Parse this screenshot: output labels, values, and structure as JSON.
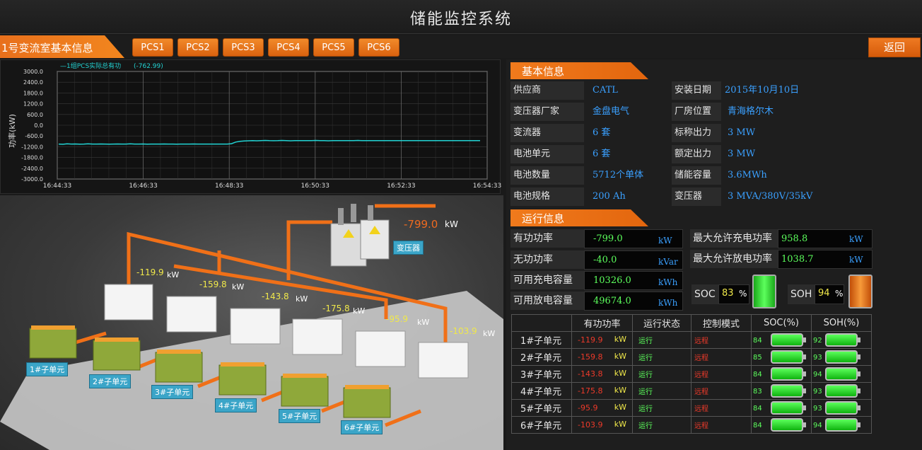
{
  "app": {
    "title": "储能监控系统"
  },
  "nav": {
    "room_tab": "1号变流室基本信息",
    "pcs_tabs": [
      "PCS1",
      "PCS2",
      "PCS3",
      "PCS4",
      "PCS5",
      "PCS6"
    ],
    "back_label": "返回"
  },
  "chart_data": {
    "type": "line",
    "legend": "—1组PCS实际总有功",
    "legend_value": "(-762.99)",
    "ylabel": "功率(kW)",
    "yticks": [
      "3000.0",
      "2400.0",
      "1800.0",
      "1200.0",
      "600.0",
      "0.0",
      "-600.0",
      "-1200.0",
      "-1800.0",
      "-2400.0",
      "-3000.0"
    ],
    "ylim": [
      -3000,
      3000
    ],
    "x": [
      "16:44:33",
      "16:46:33",
      "16:48:33",
      "16:50:33",
      "16:52:33",
      "16:54:33"
    ],
    "series": [
      {
        "name": "1组PCS实际总有功",
        "color": "#22d3d3",
        "values": [
          -1050,
          -1060,
          -1040,
          -1050,
          -1045,
          -1055,
          -1050,
          -1040,
          -1050,
          -1050,
          -1045,
          -1050,
          -1055,
          -1050,
          -1045,
          -1050,
          -1050,
          -1040,
          -1050,
          -1050,
          -1048,
          -1052,
          -1050,
          -1050,
          -1050,
          -1045,
          -1050,
          -1050,
          -1052,
          -1050,
          -1050,
          -1050,
          -1048,
          -1050,
          -1050,
          -1050,
          -1050,
          -1050,
          -1050,
          -1050,
          -1050,
          -1030,
          -940,
          -900,
          -880,
          -870,
          -860,
          -870,
          -860,
          -850,
          -860,
          -865,
          -860,
          -850,
          -860,
          -870,
          -860,
          -855,
          -860,
          -860,
          -860,
          -850,
          -860,
          -860,
          -870,
          -860,
          -855,
          -860,
          -860,
          -860,
          -860,
          -850,
          -860,
          -860,
          -860,
          -860,
          -860,
          -860,
          -860,
          -860,
          -860,
          -860,
          -855,
          -860,
          -860,
          -860,
          -860,
          -860,
          -860,
          -860,
          -860,
          -860,
          -860,
          -860,
          -860,
          -860,
          -860,
          -860,
          -860,
          -860,
          -860
        ]
      }
    ],
    "x_range": [
      "16:44:33",
      "16:54:33"
    ],
    "grid": true
  },
  "scene": {
    "transformer_power": "-799.0",
    "transformer_unit": "kW",
    "transformer_label": "变压器",
    "pcs": [
      {
        "value": "-119.9",
        "unit": "kW",
        "label": "1#子单元"
      },
      {
        "value": "-159.8",
        "unit": "kW",
        "label": "2#子单元"
      },
      {
        "value": "-143.8",
        "unit": "kW",
        "label": "3#子单元"
      },
      {
        "value": "-175.8",
        "unit": "kW",
        "label": "4#子单元"
      },
      {
        "value": "-95.9",
        "unit": "kW",
        "label": "5#子单元"
      },
      {
        "value": "-103.9",
        "unit": "kW",
        "label": "6#子单元"
      }
    ]
  },
  "basic": {
    "heading": "基本信息",
    "rows": [
      {
        "l1": "供应商",
        "v1": "CATL",
        "l2": "安装日期",
        "v2": "2015年10月10日"
      },
      {
        "l1": "变压器厂家",
        "v1": "金盘电气",
        "l2": "厂房位置",
        "v2": "青海格尔木"
      },
      {
        "l1": "变流器",
        "v1": "6 套",
        "l2": "标称出力",
        "v2": "3 MW"
      },
      {
        "l1": "电池单元",
        "v1": "6 套",
        "l2": "额定出力",
        "v2": "3 MW"
      },
      {
        "l1": "电池数量",
        "v1": "5712个单体",
        "l2": "储能容量",
        "v2": "3.6MWh"
      },
      {
        "l1": "电池规格",
        "v1": "200 Ah",
        "l2": "变压器",
        "v2": "3 MVA/380V/35kV"
      }
    ]
  },
  "running": {
    "heading": "运行信息",
    "left": [
      {
        "label": "有功功率",
        "value": "-799.0",
        "unit": "kW"
      },
      {
        "label": "无功功率",
        "value": "-40.0",
        "unit": "kVar"
      },
      {
        "label": "可用充电容量",
        "value": "10326.0",
        "unit": "kWh"
      },
      {
        "label": "可用放电容量",
        "value": "49674.0",
        "unit": "kWh"
      }
    ],
    "right": [
      {
        "label": "最大允许充电功率",
        "value": "958.8",
        "unit": "kW"
      },
      {
        "label": "最大允许放电功率",
        "value": "1038.7",
        "unit": "kW"
      }
    ],
    "soc": {
      "label": "SOC",
      "value": "83",
      "unit": "%",
      "color": "#22cc22"
    },
    "soh": {
      "label": "SOH",
      "value": "94",
      "unit": "%",
      "color": "#f07a1c"
    }
  },
  "units_table": {
    "headers": [
      "",
      "有功功率",
      "运行状态",
      "控制模式",
      "SOC(%)",
      "SOH(%)"
    ],
    "rows": [
      {
        "name": "1#子单元",
        "power": "-119.9",
        "unit": "kW",
        "state": "运行",
        "mode": "远程",
        "soc": "84",
        "soh": "92"
      },
      {
        "name": "2#子单元",
        "power": "-159.8",
        "unit": "kW",
        "state": "运行",
        "mode": "远程",
        "soc": "85",
        "soh": "93"
      },
      {
        "name": "3#子单元",
        "power": "-143.8",
        "unit": "kW",
        "state": "运行",
        "mode": "远程",
        "soc": "84",
        "soh": "94"
      },
      {
        "name": "4#子单元",
        "power": "-175.8",
        "unit": "kW",
        "state": "运行",
        "mode": "远程",
        "soc": "83",
        "soh": "93"
      },
      {
        "name": "5#子单元",
        "power": "-95.9",
        "unit": "kW",
        "state": "运行",
        "mode": "远程",
        "soc": "84",
        "soh": "93"
      },
      {
        "name": "6#子单元",
        "power": "-103.9",
        "unit": "kW",
        "state": "运行",
        "mode": "远程",
        "soc": "84",
        "soh": "94"
      }
    ]
  }
}
